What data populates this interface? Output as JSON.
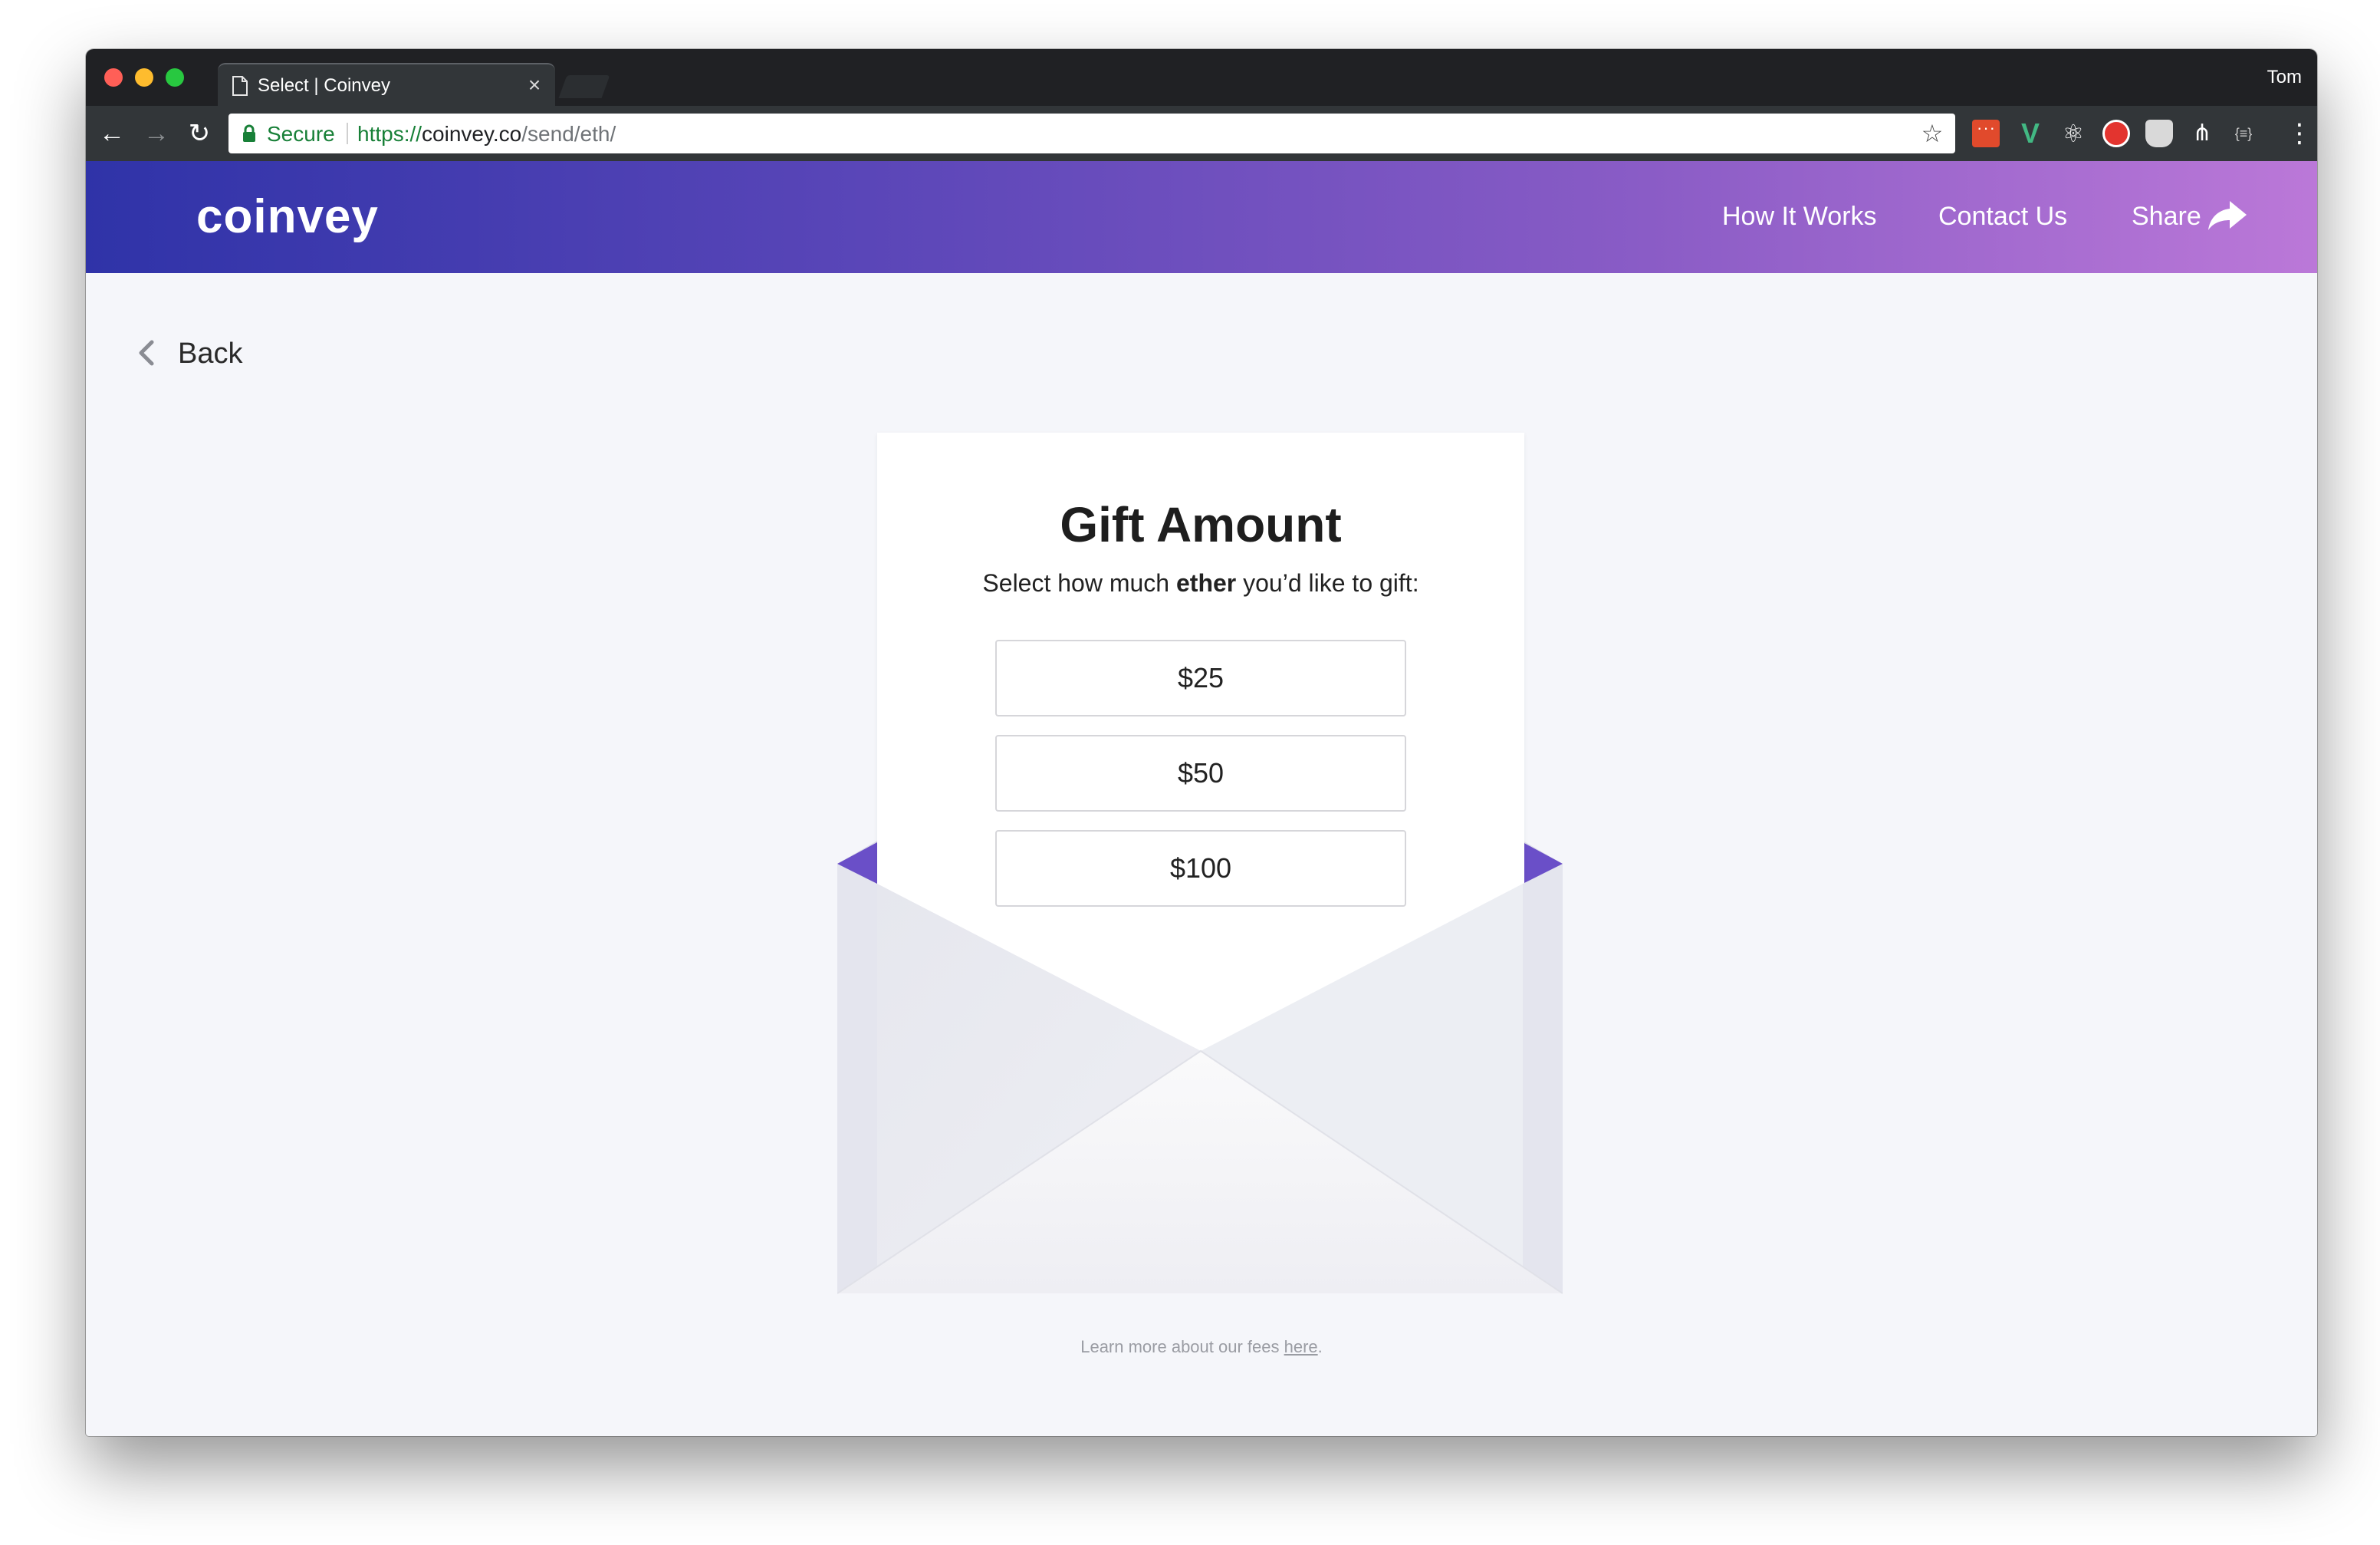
{
  "browser": {
    "tab_title": "Select | Coinvey",
    "tab_close": "×",
    "profile_name": "Tom",
    "secure_label": "Secure",
    "url_scheme": "https://",
    "url_host": "coinvey.co",
    "url_path": "/send/eth/",
    "nav_back": "←",
    "nav_forward": "→",
    "nav_reload": "↻",
    "bookmark_star": "☆",
    "menu_dots": "⋮",
    "extensions": [
      "dots-extension-icon",
      "vue-devtools-icon",
      "react-devtools-icon",
      "ublock-icon",
      "pocket-icon",
      "git-icon",
      "json-viewer-icon"
    ]
  },
  "header": {
    "logo": "coinvey",
    "nav": {
      "how_it_works": "How It Works",
      "contact_us": "Contact Us",
      "share": "Share"
    },
    "gradient_start": "#2f33a8",
    "gradient_end": "#bb78d8"
  },
  "page": {
    "back_label": "Back",
    "title": "Gift Amount",
    "subtitle_before": "Select how much ",
    "subtitle_bold": "ether",
    "subtitle_after": " you’d like to gift:",
    "amounts": [
      "$25",
      "$50",
      "$100"
    ],
    "fees_before": "Learn more about our fees ",
    "fees_link": "here",
    "fees_after": "."
  },
  "colors": {
    "page_bg": "#f5f6fa",
    "accent_purple": "#6a4fc8",
    "secure_green": "#188038"
  }
}
